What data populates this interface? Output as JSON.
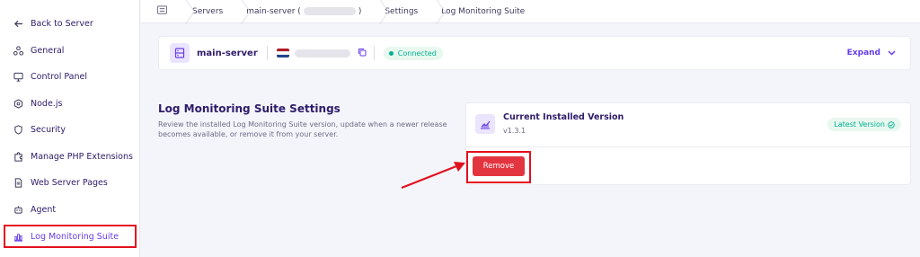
{
  "sidebar": {
    "back_label": "Back to Server",
    "items": [
      {
        "label": "General",
        "icon": "nodes-icon"
      },
      {
        "label": "Control Panel",
        "icon": "monitor-icon"
      },
      {
        "label": "Node.js",
        "icon": "hexagon-icon"
      },
      {
        "label": "Security",
        "icon": "shield-icon"
      },
      {
        "label": "Manage PHP Extensions",
        "icon": "puzzle-icon"
      },
      {
        "label": "Web Server Pages",
        "icon": "document-icon"
      },
      {
        "label": "Agent",
        "icon": "robot-icon"
      },
      {
        "label": "Log Monitoring Suite",
        "icon": "chart-bars-icon",
        "active": true
      }
    ]
  },
  "breadcrumb": {
    "home_icon": "list-icon",
    "servers": "Servers",
    "server_prefix": "main-server (",
    "server_suffix": ")",
    "settings": "Settings",
    "current": "Log Monitoring Suite"
  },
  "server_card": {
    "name": "main-server",
    "status": "Connected",
    "expand_label": "Expand",
    "flag_colors": [
      "#ae1c28",
      "#ffffff",
      "#21468b"
    ]
  },
  "section": {
    "title": "Log Monitoring Suite Settings",
    "description": "Review the installed Log Monitoring Suite version, update when a newer release becomes available, or remove it from your server."
  },
  "version_card": {
    "title": "Current Installed Version",
    "version": "v1.3.1",
    "badge": "Latest Version",
    "remove_label": "Remove"
  },
  "colors": {
    "accent": "#673de6",
    "danger": "#e3353f",
    "success": "#00b090",
    "annotation": "#e3101e"
  }
}
